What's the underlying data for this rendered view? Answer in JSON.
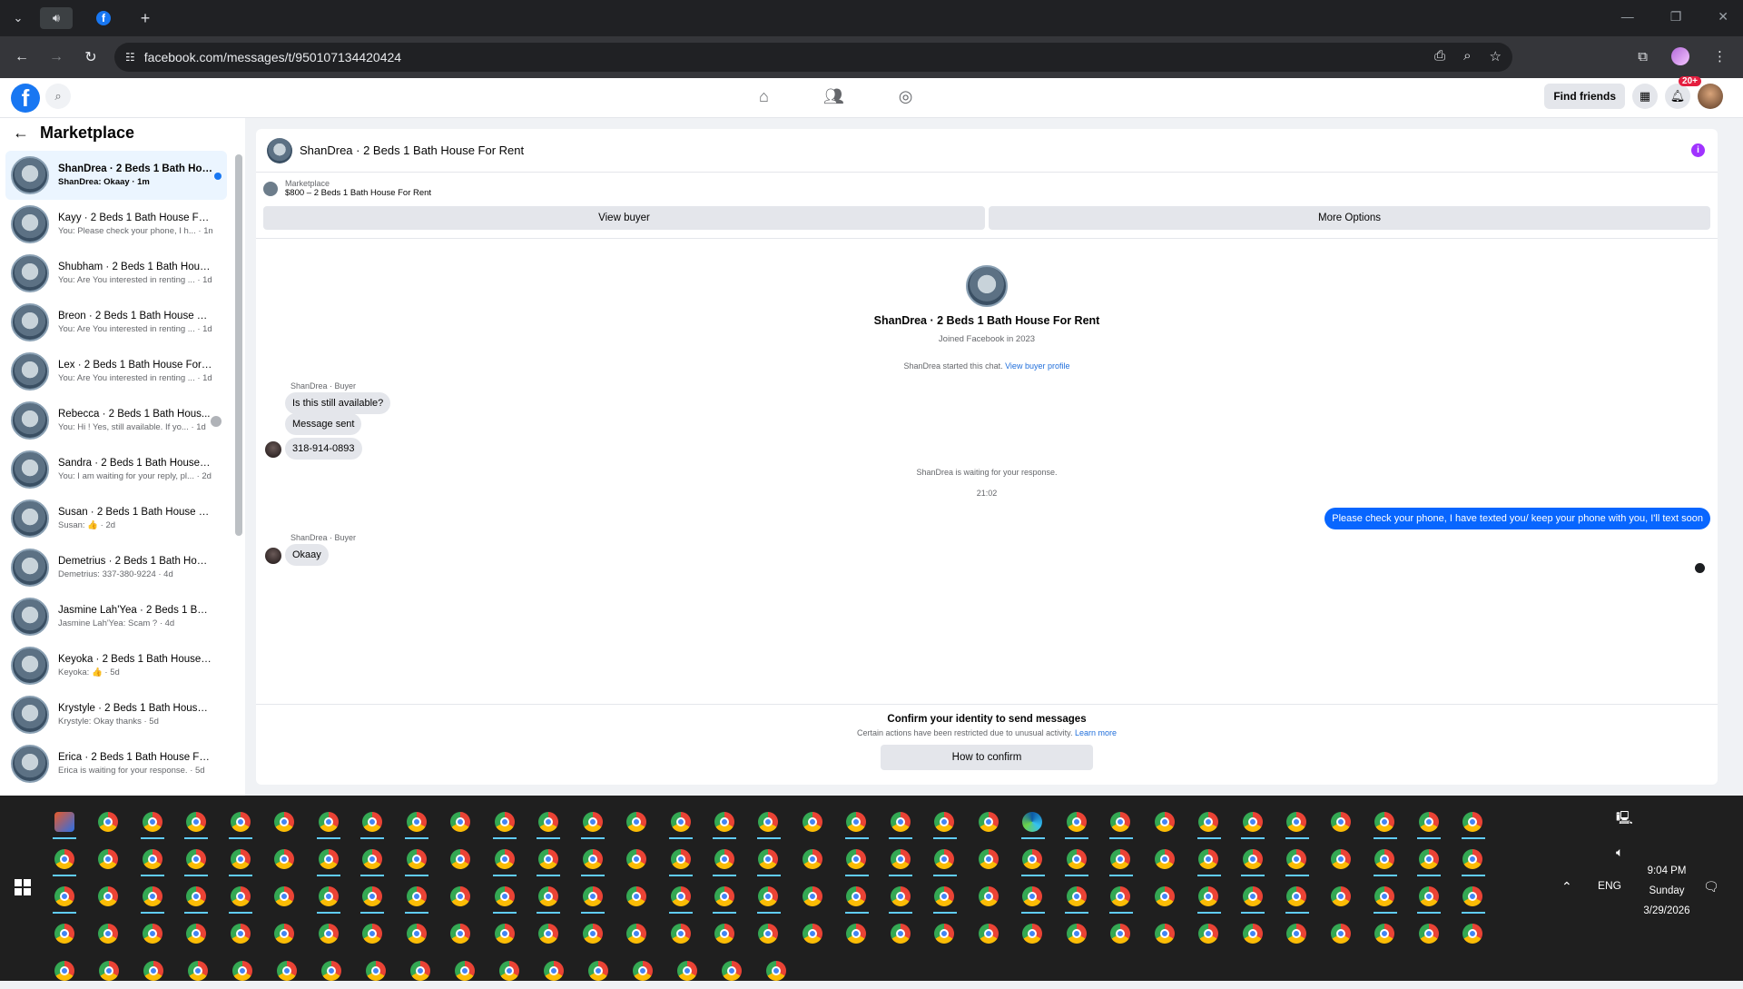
{
  "browser": {
    "url": "facebook.com/messages/t/950107134420424",
    "window_controls": [
      "—",
      "❐",
      "✕"
    ]
  },
  "facebook": {
    "find_friends_label": "Find friends",
    "notification_count": "20+"
  },
  "sidebar": {
    "title": "Marketplace",
    "conversations": [
      {
        "name": "ShanDrea · 2 Beds 1 Bath Hou...",
        "snippet": "ShanDrea: Okaay · 1m",
        "active": true
      },
      {
        "name": "Kayy · 2 Beds 1 Bath House For ...",
        "snippet": "You: Please check your phone, I h... · 1m"
      },
      {
        "name": "Shubham · 2 Beds 1 Bath House...",
        "snippet": "You: Are You interested in renting ... · 1d"
      },
      {
        "name": "Breon · 2 Beds 1 Bath House Fo...",
        "snippet": "You: Are You interested in renting ... · 1d"
      },
      {
        "name": "Lex · 2 Beds 1 Bath House For R...",
        "snippet": "You: Are You interested in renting ... · 1d"
      },
      {
        "name": "Rebecca · 2 Beds 1 Bath Hous...",
        "snippet": "You: Hi ! Yes, still available. If yo... · 1d"
      },
      {
        "name": "Sandra · 2 Beds 1 Bath House F...",
        "snippet": "You: I am waiting for your reply, pl... · 2d"
      },
      {
        "name": "Susan · 2 Beds 1 Bath House For...",
        "snippet": "Susan: 👍 · 2d"
      },
      {
        "name": "Demetrius · 2 Beds 1 Bath Hous...",
        "snippet": "Demetrius: 337-380-9224 · 4d"
      },
      {
        "name": "Jasmine Lah'Yea · 2 Beds 1 Bath ...",
        "snippet": "Jasmine Lah'Yea: Scam ? · 4d"
      },
      {
        "name": "Keyoka · 2 Beds 1 Bath House F...",
        "snippet": "Keyoka: 👍 · 5d"
      },
      {
        "name": "Krystyle · 2 Beds 1 Bath House F...",
        "snippet": "Krystyle: Okay thanks · 5d"
      },
      {
        "name": "Erica · 2 Beds 1 Bath House For ...",
        "snippet": "Erica is waiting for your response. · 5d"
      }
    ]
  },
  "chat": {
    "title": "ShanDrea · 2 Beds 1 Bath House For Rent",
    "listing_label": "Marketplace",
    "listing_price": "$800 – 2 Beds 1 Bath House For Rent",
    "view_buyer_label": "View buyer",
    "more_options_label": "More Options",
    "profile_name": "ShanDrea · 2 Beds 1 Bath House For Rent",
    "profile_joined": "Joined Facebook in 2023",
    "started_text": "ShanDrea started this chat.",
    "view_buyer_profile": "View buyer profile",
    "sender_label": "ShanDrea · Buyer",
    "messages_in": [
      "Is this still available?",
      "Message sent",
      "318-914-0893"
    ],
    "waiting_text": "ShanDrea is waiting for your response.",
    "timestamp": "21:02",
    "message_out": "Please check your phone, I have texted you/ keep your phone with you, I'll text soon",
    "sender_label_2": "ShanDrea · Buyer",
    "message_last": "Okaay",
    "confirm_title": "Confirm your identity to send messages",
    "confirm_sub": "Certain actions have been restricted due to unusual activity.",
    "learn_more": "Learn more",
    "confirm_button": "How to confirm"
  },
  "taskbar": {
    "language": "ENG",
    "time": "9:04 PM",
    "day": "Sunday",
    "date": "3/29/2026",
    "rows": [
      33,
      33,
      33,
      33,
      17
    ]
  }
}
